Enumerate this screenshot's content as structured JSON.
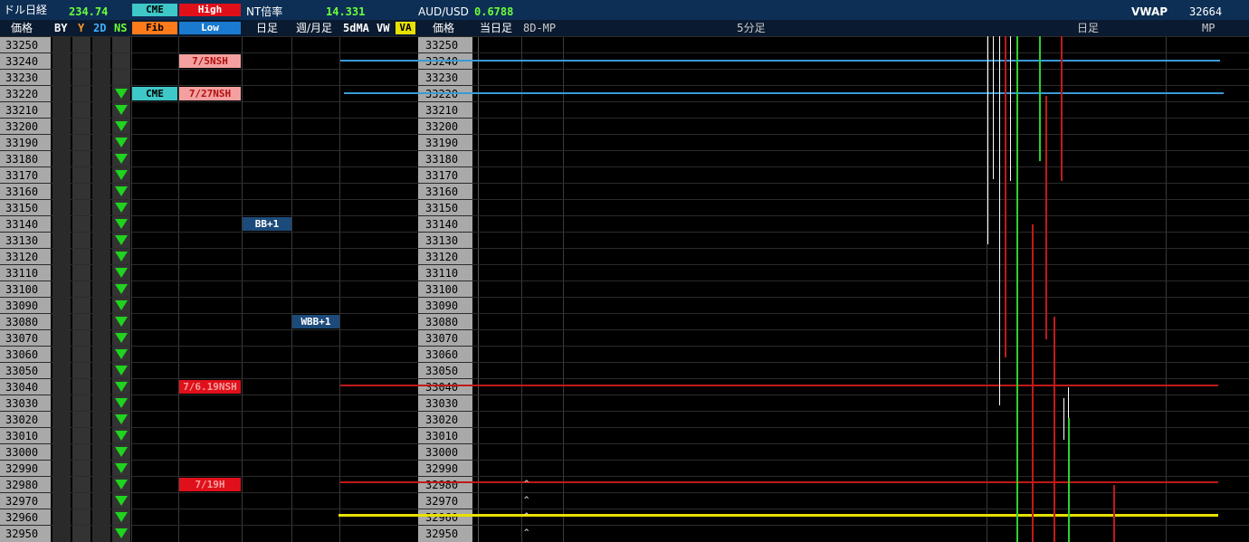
{
  "header": {
    "title": "ドル日経",
    "value1": "234.74",
    "btn_cme": "CME",
    "btn_high": "High",
    "btn_fib": "Fib",
    "btn_low": "Low",
    "nt_label": "NT倍率",
    "nt_value": "14.331",
    "aud_label": "AUD/USD",
    "aud_value": "0.6788",
    "vwap_label": "VWAP",
    "vwap_value": "32664"
  },
  "columns": {
    "price": "価格",
    "by": "BY",
    "y": "Y",
    "d2": "2D",
    "ns": "NS",
    "daily": "日足",
    "weekly": "週/月足",
    "ma5": "5dMA",
    "vw": "VW",
    "va": "VA",
    "price2": "価格",
    "today": "当日足",
    "mp8d": "8D-MP",
    "min5": "5分足",
    "daily2": "日足",
    "mp": "MP"
  },
  "prices": [
    "33250",
    "33240",
    "33230",
    "33220",
    "33210",
    "33200",
    "33190",
    "33180",
    "33170",
    "33160",
    "33150",
    "33140",
    "33130",
    "33120",
    "33110",
    "33100",
    "33090",
    "33080",
    "33070",
    "33060",
    "33050",
    "33040",
    "33030",
    "33020",
    "33010",
    "33000",
    "32990",
    "32980",
    "32970",
    "32960",
    "32950"
  ],
  "ns_arrow_start_index": 3,
  "tags": {
    "nsh_7_5": "7/5NSH",
    "nsh_7_27": "7/27NSH",
    "cme_level": "CME",
    "nsh_7_6_19": "7/6.19NSH",
    "ch_7_19": "7/19H",
    "bb_daily": "BB+1",
    "bb_weekly": "WBB+1"
  },
  "colors": {
    "header_bg": "#0d2f55",
    "arrow_green": "#1fd31f",
    "cme_teal": "#3fc8c8",
    "high_red": "#e0101a",
    "fib_orange": "#ff7a1a",
    "low_blue": "#1a7ad0",
    "nsh_pink": "#f4a0a0",
    "bb_navy": "#1c4a7a",
    "line_blue": "#3a9ad6",
    "line_red": "#c01a1a",
    "line_yellow": "#e8e000"
  }
}
